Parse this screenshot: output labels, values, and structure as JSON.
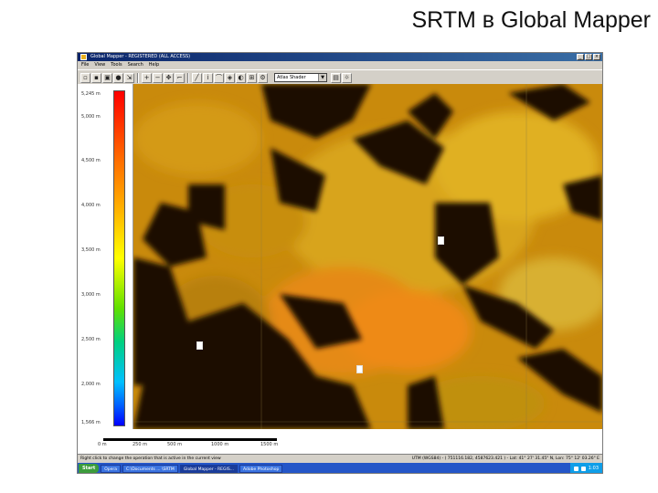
{
  "slide": {
    "title": "SRTM в Global Mapper"
  },
  "window": {
    "title": "Global Mapper - REGISTERED (ALL ACCESS)"
  },
  "menu": [
    "File",
    "View",
    "Tools",
    "Search",
    "Help"
  ],
  "toolbar": {
    "shader_value": "Atlas Shader"
  },
  "legend": {
    "labels": [
      "5,245 m",
      "5,000 m",
      "4,500 m",
      "4,000 m",
      "3,500 m",
      "3,000 m",
      "2,500 m",
      "2,000 m",
      "1,566 m"
    ],
    "colors": [
      "#ff0000",
      "#ff6a00",
      "#ffb000",
      "#ffff00",
      "#60e000",
      "#00d080",
      "#00c0ff",
      "#0060ff",
      "#0000ff"
    ]
  },
  "scale": {
    "labels": [
      "0 m",
      "250 m",
      "500 m",
      "1000 m",
      "1500 m"
    ]
  },
  "status": {
    "hint": "Right click to change the operation that is active in the current view",
    "coords": "UTM (WGS84) - ( 751116.182, 4587623.421 ) - Lat: 41° 27' 31.45\" N, Lon: 75° 12' 03.26\" E"
  },
  "taskbar": {
    "start": "Start",
    "items": [
      "Opera",
      "C:\\Documents ... \\SRTM",
      "Global Mapper - REGIS...",
      "Adobe Photoshop"
    ],
    "clock": "1:03"
  }
}
